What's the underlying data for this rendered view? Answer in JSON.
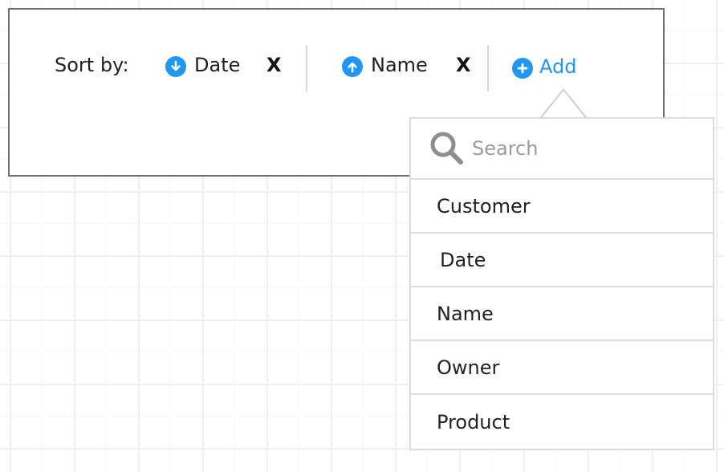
{
  "sort_bar": {
    "label": "Sort by:",
    "items": [
      {
        "label": "Date",
        "direction": "descending",
        "icon": "arrow-down-circle-icon",
        "remove": "X"
      },
      {
        "label": "Name",
        "direction": "ascending",
        "icon": "arrow-up-circle-icon",
        "remove": "X"
      }
    ],
    "add_label": "Add",
    "add_icon": "plus-circle-icon"
  },
  "dropdown": {
    "search_placeholder": "Search",
    "search_value": "",
    "options": [
      "Customer",
      "Date",
      "Name",
      "Owner",
      "Product"
    ]
  },
  "colors": {
    "accent": "#2196f3",
    "panel_border": "#6f6f6f",
    "dropdown_border": "#dcdcdc"
  }
}
